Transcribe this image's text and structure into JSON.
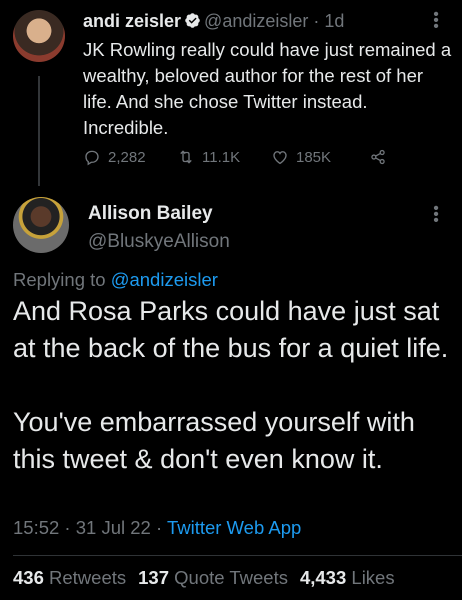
{
  "tweet1": {
    "display_name": "andi zeisler",
    "handle": "@andizeisler",
    "time_sep": " · ",
    "time": "1d",
    "text": "JK Rowling really could have just remained a wealthy, beloved author for the rest of her life. And she chose Twitter instead. Incredible.",
    "actions": {
      "replies": "2,282",
      "retweets": "11.1K",
      "likes": "185K"
    }
  },
  "tweet2": {
    "display_name": "Allison Bailey",
    "handle": "@BluskyeAllison",
    "replying_prefix": "Replying to ",
    "replying_to": "@andizeisler",
    "text": "And Rosa Parks could have just sat at the back of the bus for a quiet life.\n\nYou've embarrassed yourself with this tweet & don't even know it.",
    "timestamp": "15:52 · 31 Jul 22 · ",
    "source": "Twitter Web App",
    "stats": {
      "retweets_count": "436",
      "retweets_label": "Retweets",
      "quotes_count": "137",
      "quotes_label": "Quote Tweets",
      "likes_count": "4,433",
      "likes_label": "Likes"
    }
  },
  "colors": {
    "background": "#000000",
    "text": "#e7e9ea",
    "muted": "#71767b",
    "accent": "#1d9bf0"
  },
  "icons": [
    "verified-badge-icon",
    "more-options-icon",
    "reply-icon",
    "retweet-icon",
    "like-icon",
    "share-icon"
  ]
}
